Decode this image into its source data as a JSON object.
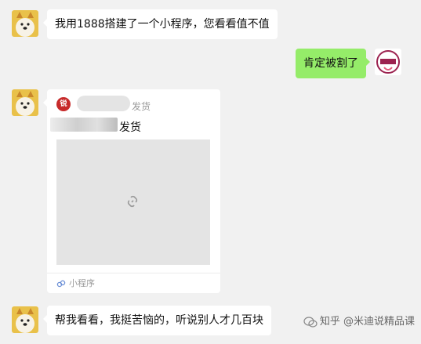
{
  "chat": {
    "msg1": {
      "text": "我用1888搭建了一个小程序，您看看值不值",
      "avatar_icon": "shiba-dog-avatar-icon"
    },
    "msg2": {
      "text": "肯定被割了",
      "avatar_icon": "brand-logo-avatar-icon"
    },
    "msg4": {
      "text": "帮我看看，我挺苦恼的，听说别人才几百块",
      "avatar_icon": "shiba-dog-avatar-icon"
    }
  },
  "card": {
    "logo_text": "锐",
    "source_tail": "发货",
    "title_tail": "发货",
    "thumb_icon": "link-icon",
    "footer_label": "小程序"
  },
  "watermark": {
    "text": "知乎 @米迪说精品课"
  },
  "colors": {
    "bg": "#f1f1f1",
    "self_bubble": "#95ec69",
    "other_bubble": "#ffffff"
  }
}
